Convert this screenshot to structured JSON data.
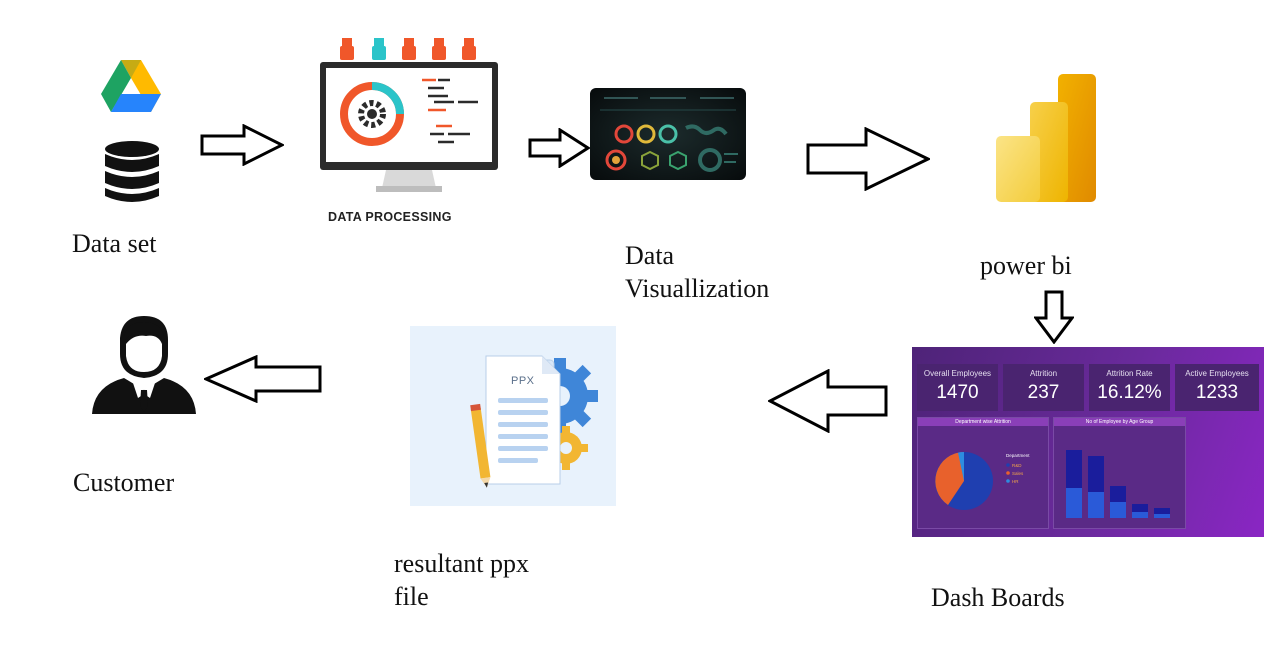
{
  "labels": {
    "dataset": "Data set",
    "data_processing_caption": "DATA PROCESSING",
    "data_visualization_line1": "Data",
    "data_visualization_line2": "Visuallization",
    "power_bi": "power bi",
    "dash_boards": "Dash Boards",
    "resultant_line1": "resultant ppx",
    "resultant_line2": "file",
    "customer": "Customer"
  },
  "ppx_doc_label": "PPX",
  "dashboard": {
    "kpis": [
      {
        "title": "Overall Employees",
        "value": "1470"
      },
      {
        "title": "Attrition",
        "value": "237"
      },
      {
        "title": "Attrition Rate",
        "value": "16.12%"
      },
      {
        "title": "Active Employees",
        "value": "1233"
      }
    ],
    "panel_left_title": "Department wise Attrition",
    "panel_right_title": "No of Employee by Age Group",
    "legend_title": "Department",
    "legend_items": [
      "R&D",
      "Sales",
      "HR"
    ],
    "colors": {
      "bg": "#6a2a9c",
      "card": "#4a2470",
      "rd": "#1f3fb0",
      "sales": "#e8612c",
      "hr": "#2d8ce0"
    }
  },
  "colors": {
    "drive_green": "#1ea362",
    "drive_yellow": "#ffba00",
    "drive_blue": "#2684fc",
    "powerbi_dark": "#e8a300",
    "powerbi_mid": "#f2c200",
    "powerbi_light": "#f7db5a",
    "monitor_frame": "#2b2b2b",
    "accent_orange": "#f0572a",
    "accent_teal": "#2bc4c9"
  }
}
